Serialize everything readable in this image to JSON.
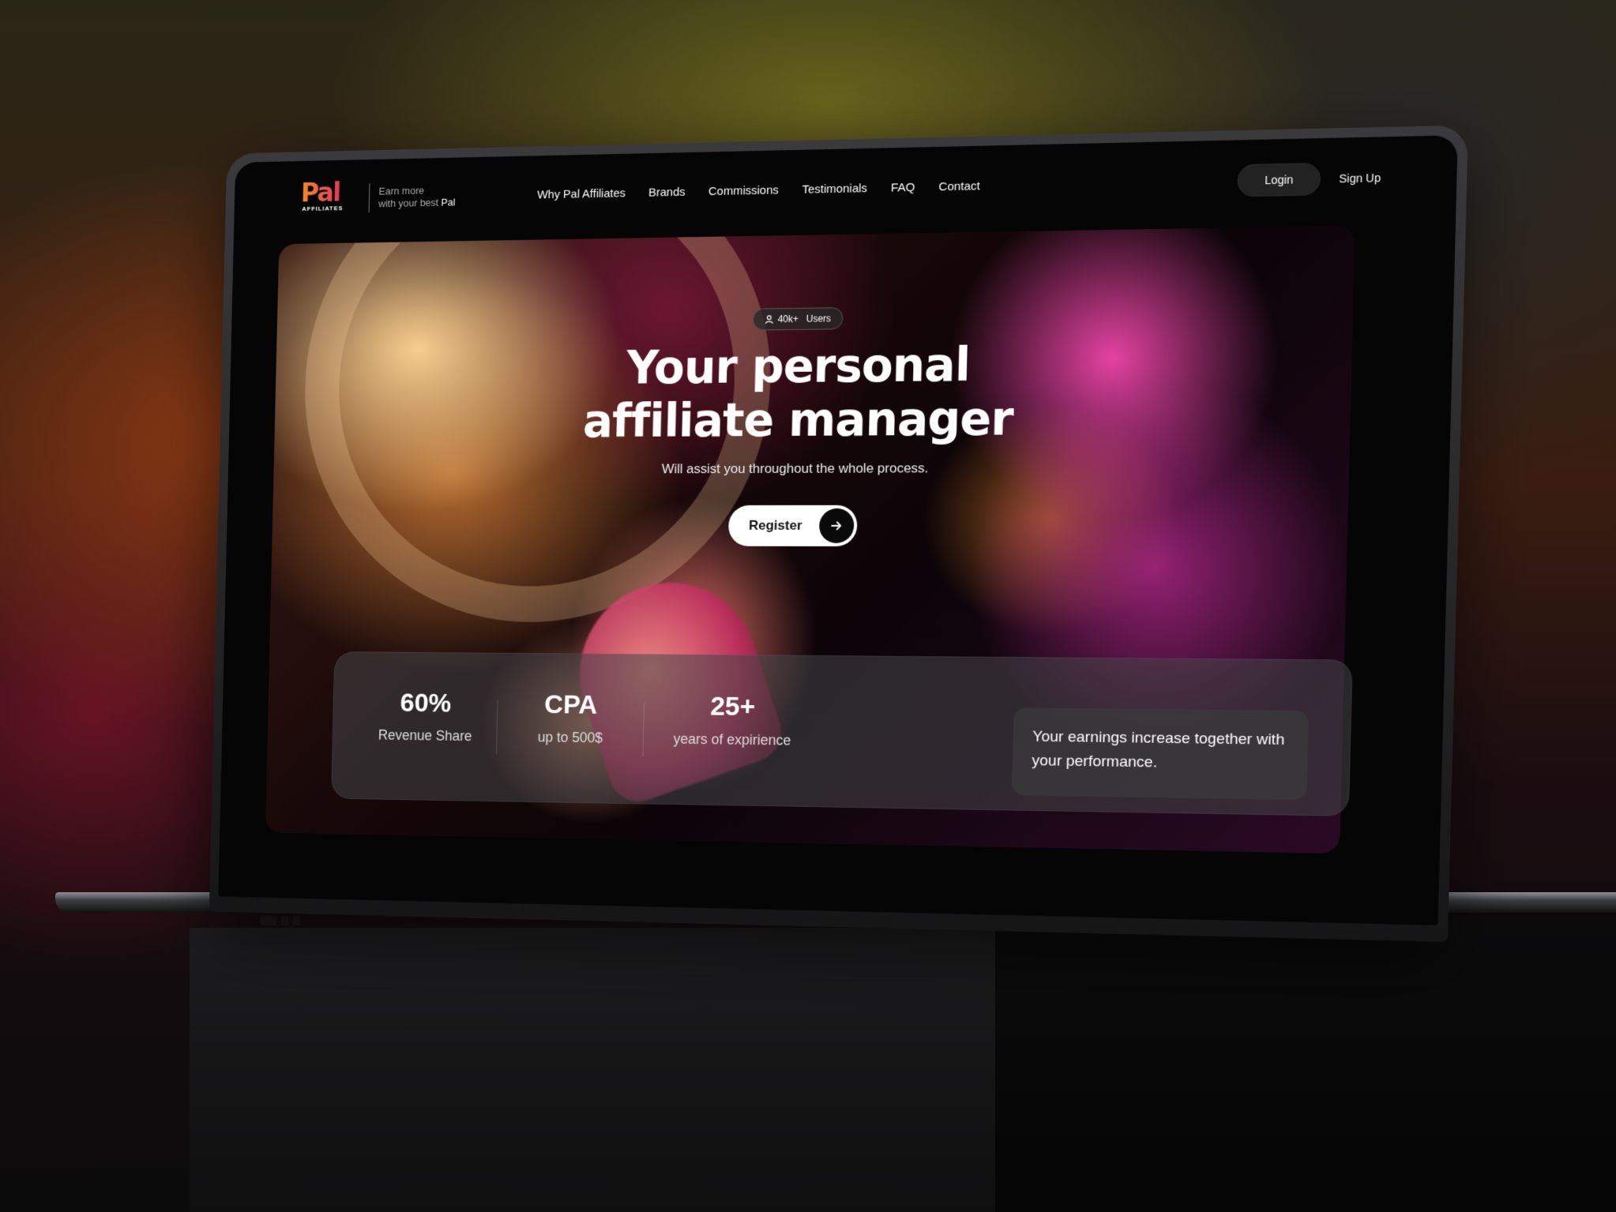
{
  "brand": {
    "logo_text": "Pal",
    "logo_sub": "AFFILIATES",
    "tagline_line1": "Earn more",
    "tagline_line2": "with your best",
    "tagline_pal": "Pal",
    "accent_gradient": [
      "#f58a2a",
      "#e1395c"
    ]
  },
  "nav": {
    "links": [
      "Why Pal Affiliates",
      "Brands",
      "Commissions",
      "Testimonials",
      "FAQ",
      "Contact"
    ],
    "login": "Login",
    "signup": "Sign Up"
  },
  "hero": {
    "badge_count": "40k+",
    "badge_label": "Users",
    "badge_icon": "user-icon",
    "title_line1": "Your personal",
    "title_line2": "affiliate manager",
    "subtitle": "Will assist you throughout the whole process.",
    "cta_label": "Register",
    "cta_icon": "arrow-right-icon"
  },
  "stats": [
    {
      "value": "60%",
      "label": "Revenue Share"
    },
    {
      "value": "CPA",
      "label": "up to 500$"
    },
    {
      "value": "25+",
      "label": "years of expirience"
    }
  ],
  "earnings_text": "Your earnings increase together with your performance."
}
